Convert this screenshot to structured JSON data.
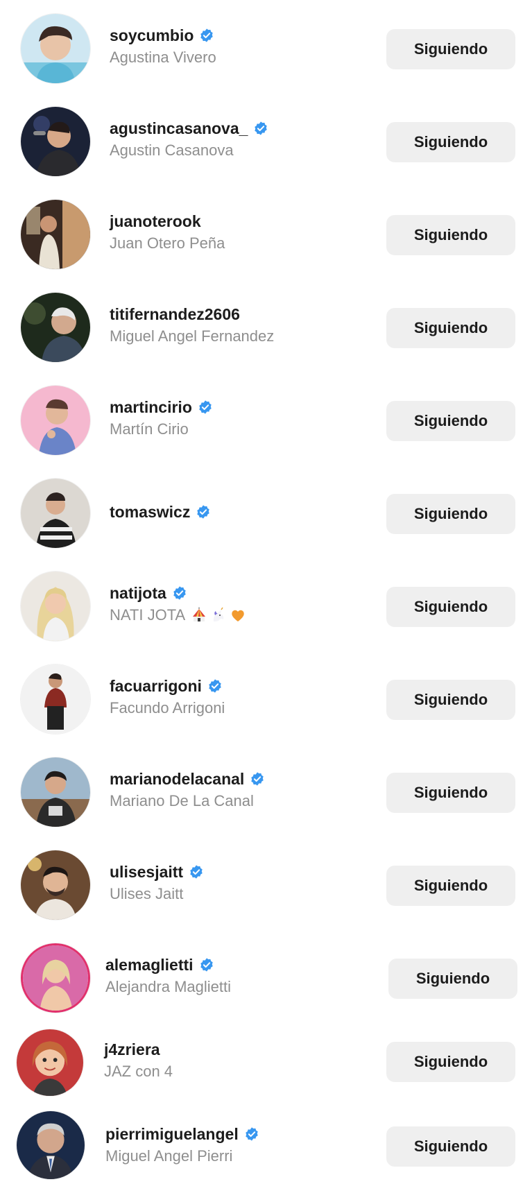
{
  "following": [
    {
      "username": "soycumbio",
      "name": "Agustina Vivero",
      "verified": true,
      "button": "Siguiendo",
      "avatar_icon": "profile-photo"
    },
    {
      "username": "agustincasanova_",
      "name": "Agustin Casanova",
      "verified": true,
      "button": "Siguiendo",
      "avatar_icon": "profile-photo"
    },
    {
      "username": "juanoterook",
      "name": "Juan Otero Peña",
      "verified": false,
      "button": "Siguiendo",
      "avatar_icon": "profile-photo"
    },
    {
      "username": "titifernandez2606",
      "name": "Miguel Angel Fernandez",
      "verified": false,
      "button": "Siguiendo",
      "avatar_icon": "profile-photo"
    },
    {
      "username": "martincirio",
      "name": "Martín Cirio",
      "verified": true,
      "button": "Siguiendo",
      "avatar_icon": "profile-photo"
    },
    {
      "username": "tomaswicz",
      "name": "",
      "verified": true,
      "button": "Siguiendo",
      "avatar_icon": "profile-photo"
    },
    {
      "username": "natijota",
      "name": "NATI JOTA",
      "verified": true,
      "button": "Siguiendo",
      "avatar_icon": "profile-photo",
      "emojis": [
        "circus-tent-emoji",
        "unicorn-emoji",
        "orange-heart-emoji"
      ]
    },
    {
      "username": "facuarrigoni",
      "name": "Facundo Arrigoni",
      "verified": true,
      "button": "Siguiendo",
      "avatar_icon": "profile-photo"
    },
    {
      "username": "marianodelacanal",
      "name": "Mariano De La Canal",
      "verified": true,
      "button": "Siguiendo",
      "avatar_icon": "profile-photo"
    },
    {
      "username": "ulisesjaitt",
      "name": "Ulises Jaitt",
      "verified": true,
      "button": "Siguiendo",
      "avatar_icon": "profile-photo"
    },
    {
      "username": "alemaglietti",
      "name": "Alejandra Maglietti",
      "verified": true,
      "button": "Siguiendo",
      "avatar_icon": "profile-photo"
    },
    {
      "username": "j4zriera",
      "name": "JAZ con 4",
      "verified": false,
      "button": "Siguiendo",
      "avatar_icon": "profile-photo"
    },
    {
      "username": "pierrimiguelangel",
      "name": "Miguel Angel Pierri",
      "verified": true,
      "button": "Siguiendo",
      "avatar_icon": "profile-photo"
    }
  ],
  "colors": {
    "verified_badge": "#3897f0",
    "button_bg": "#efefef",
    "username_text": "#1c1c1c",
    "name_text": "#8e8e8e"
  }
}
